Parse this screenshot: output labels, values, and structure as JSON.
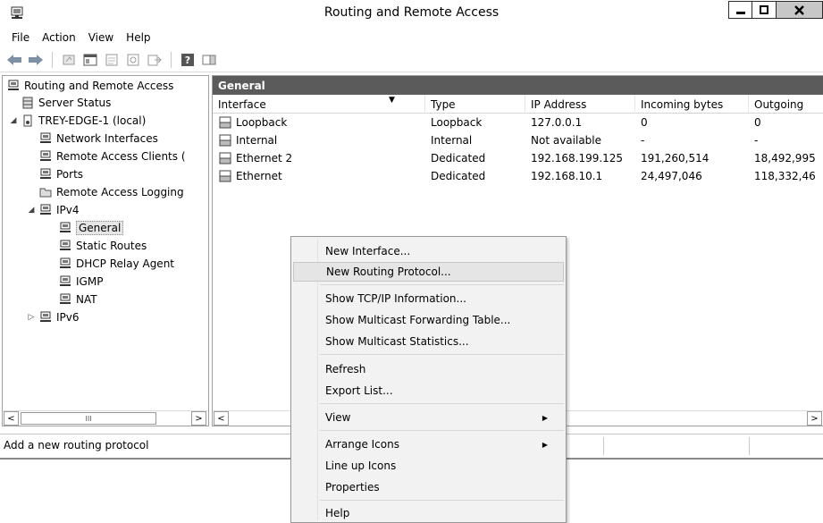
{
  "window": {
    "title": "Routing and Remote Access",
    "controls": {
      "minimize": "▁",
      "maximize": "□",
      "close": "✕"
    }
  },
  "menubar": {
    "items": [
      "File",
      "Action",
      "View",
      "Help"
    ]
  },
  "toolbar": {
    "buttons": [
      "back-icon",
      "forward-icon",
      "up-icon",
      "show-hide-tree-icon",
      "properties-icon",
      "refresh-icon",
      "export-icon",
      "help-icon",
      "action-pane-icon"
    ]
  },
  "tree": {
    "root": "Routing and Remote Access",
    "server_status": "Server Status",
    "server": "TREY-EDGE-1 (local)",
    "network_interfaces": "Network Interfaces",
    "remote_access_clients": "Remote Access Clients (",
    "ports": "Ports",
    "remote_access_logging": "Remote Access Logging",
    "ipv4": "IPv4",
    "general": "General",
    "static_routes": "Static Routes",
    "dhcp_relay": "DHCP Relay Agent",
    "igmp": "IGMP",
    "nat": "NAT",
    "ipv6": "IPv6"
  },
  "list": {
    "header": "General",
    "columns": [
      "Interface",
      "Type",
      "IP Address",
      "Incoming bytes",
      "Outgoing"
    ],
    "rows": [
      {
        "interface": "Loopback",
        "type": "Loopback",
        "ip": "127.0.0.1",
        "incoming": "0",
        "outgoing": "0"
      },
      {
        "interface": "Internal",
        "type": "Internal",
        "ip": "Not available",
        "incoming": "-",
        "outgoing": "-"
      },
      {
        "interface": "Ethernet 2",
        "type": "Dedicated",
        "ip": "192.168.199.125",
        "incoming": "191,260,514",
        "outgoing": "18,492,995"
      },
      {
        "interface": "Ethernet",
        "type": "Dedicated",
        "ip": "192.168.10.1",
        "incoming": "24,497,046",
        "outgoing": "118,332,46"
      }
    ]
  },
  "scrollbars": {
    "left_thumb": "III",
    "left": "<",
    "right": ">"
  },
  "statusbar": {
    "text": "Add a new routing protocol"
  },
  "context_menu": {
    "items": {
      "new_interface": "New Interface...",
      "new_routing_protocol": "New Routing Protocol...",
      "show_tcpip": "Show TCP/IP Information...",
      "show_mcast_table": "Show Multicast Forwarding Table...",
      "show_mcast_stats": "Show Multicast Statistics...",
      "refresh": "Refresh",
      "export_list": "Export List...",
      "view": "View",
      "arrange_icons": "Arrange Icons",
      "line_up_icons": "Line up Icons",
      "properties": "Properties",
      "help": "Help"
    },
    "submenu_arrow": "▶",
    "highlighted": "New Routing Protocol..."
  }
}
